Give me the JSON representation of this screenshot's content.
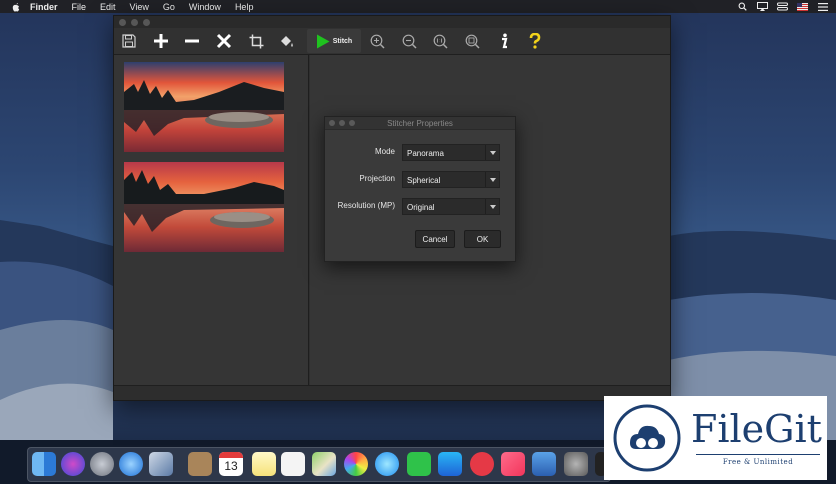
{
  "menubar": {
    "items": [
      {
        "label": "Finder",
        "bold": true
      },
      {
        "label": "File"
      },
      {
        "label": "Edit"
      },
      {
        "label": "View"
      },
      {
        "label": "Go"
      },
      {
        "label": "Window"
      },
      {
        "label": "Help"
      }
    ]
  },
  "toolbar": {
    "stitch_label": "Stitch",
    "tools": [
      "save-icon",
      "add-icon",
      "remove-icon",
      "delete-icon",
      "crop-icon",
      "fill-icon",
      "stitch-play-icon",
      "zoom-in-icon",
      "zoom-out-icon",
      "zoom-actual-icon",
      "zoom-fit-icon",
      "info-icon",
      "help-icon"
    ]
  },
  "dialog": {
    "title": "Stitcher Properties",
    "mode_label": "Mode",
    "mode_value": "Panorama",
    "projection_label": "Projection",
    "projection_value": "Spherical",
    "resolution_label": "Resolution (MP)",
    "resolution_value": "Original",
    "cancel_label": "Cancel",
    "ok_label": "OK"
  },
  "calendar_day": "13",
  "watermark": {
    "name": "FileGit",
    "tagline": "Free & Unlimited"
  },
  "colors": {
    "stitch_green": "#1fc21f",
    "help_yellow": "#f2d21b",
    "filegit_blue": "#1d3f70"
  }
}
